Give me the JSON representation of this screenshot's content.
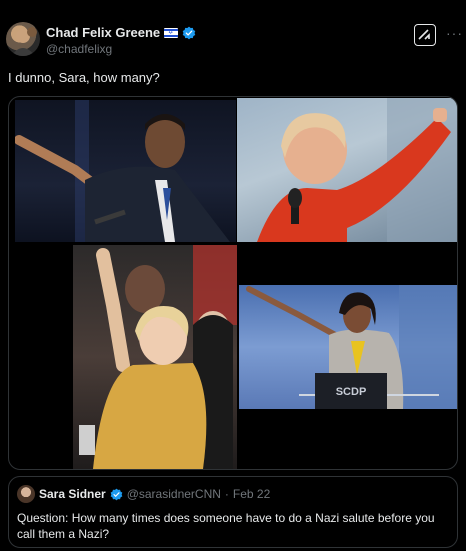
{
  "author": {
    "display_name": "Chad Felix Greene",
    "handle": "@chadfelixg",
    "flag": "israel-flag",
    "verified": true
  },
  "actions": {
    "grok_icon": "grok-icon",
    "more_label": "···"
  },
  "tweet": {
    "text": "I dunno, Sara, how many?"
  },
  "media": {
    "photos": [
      {
        "subject": "obama-photo"
      },
      {
        "subject": "warren-photo"
      },
      {
        "subject": "clinton-photo"
      },
      {
        "subject": "harris-photo",
        "podium_text": "SCDP"
      }
    ]
  },
  "quote": {
    "display_name": "Sara Sidner",
    "handle": "@sarasidnerCNN",
    "separator": "·",
    "date": "Feb 22",
    "text": "Question: How many times does someone have to do a Nazi salute before you call them a Nazi?"
  },
  "colors": {
    "background": "#000000",
    "text": "#e7e9ea",
    "muted": "#71767b",
    "border": "#2f3336",
    "verified": "#1d9bf0",
    "flag_blue": "#1f4fd1"
  }
}
